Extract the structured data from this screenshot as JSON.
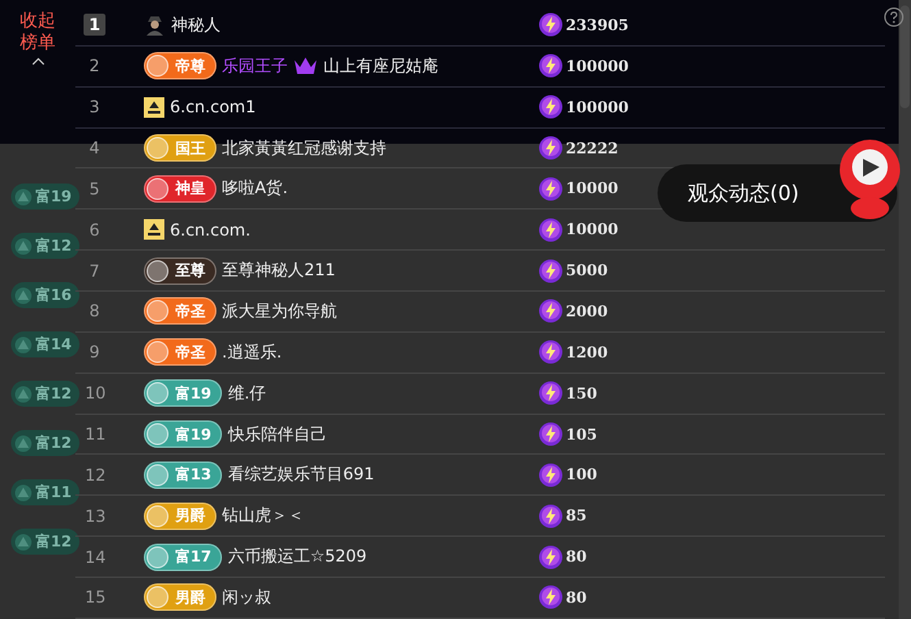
{
  "collapse_button": {
    "label": "收起榜单"
  },
  "chat_badges": [
    {
      "label": "富19"
    },
    {
      "label": "富12"
    },
    {
      "label": "富16"
    },
    {
      "label": "富14"
    },
    {
      "label": "富12"
    },
    {
      "label": "富12"
    },
    {
      "label": "富11"
    },
    {
      "label": "富12"
    }
  ],
  "leaderboard": {
    "rows": [
      {
        "rank": "1",
        "badge": {
          "kind": "avatar"
        },
        "name": "神秘人",
        "score": "233905"
      },
      {
        "rank": "2",
        "badge": {
          "kind": "title",
          "label": "帝尊",
          "color": "#f26a1b"
        },
        "name_highlight": "乐园王子",
        "crown": true,
        "name": "山上有座尼姑庵",
        "score": "100000"
      },
      {
        "rank": "3",
        "badge": {
          "kind": "site"
        },
        "name": "6.cn.com1",
        "score": "100000"
      },
      {
        "rank": "4",
        "badge": {
          "kind": "title",
          "label": "国王",
          "color": "#e0a012"
        },
        "name": "北家黃黃红冠感谢支持",
        "score": "22222"
      },
      {
        "rank": "5",
        "badge": {
          "kind": "title",
          "label": "神皇",
          "color": "#e0262b"
        },
        "name": "哆啦A货.",
        "score": "10000"
      },
      {
        "rank": "6",
        "badge": {
          "kind": "site"
        },
        "name": "6.cn.com.",
        "score": "10000"
      },
      {
        "rank": "7",
        "badge": {
          "kind": "title",
          "label": "至尊",
          "color": "#3a2a22"
        },
        "name": "至尊神秘人211",
        "score": "5000"
      },
      {
        "rank": "8",
        "badge": {
          "kind": "title",
          "label": "帝圣",
          "color": "#f26a1b"
        },
        "name": "派大星为你导航",
        "score": "2000"
      },
      {
        "rank": "9",
        "badge": {
          "kind": "title",
          "label": "帝圣",
          "color": "#f26a1b"
        },
        "name": ".逍遥乐.",
        "score": "1200"
      },
      {
        "rank": "10",
        "badge": {
          "kind": "wealth",
          "label": "富19",
          "color": "#3aa597"
        },
        "name": "维.仔",
        "score": "150"
      },
      {
        "rank": "11",
        "badge": {
          "kind": "wealth",
          "label": "富19",
          "color": "#3aa597"
        },
        "name": "快乐陪伴自己",
        "score": "105"
      },
      {
        "rank": "12",
        "badge": {
          "kind": "wealth",
          "label": "富13",
          "color": "#3aa597"
        },
        "name": "看综艺娱乐节目691",
        "score": "100"
      },
      {
        "rank": "13",
        "badge": {
          "kind": "title",
          "label": "男爵",
          "color": "#e0a012"
        },
        "name": "钻山虎＞＜",
        "score": "85"
      },
      {
        "rank": "14",
        "badge": {
          "kind": "wealth",
          "label": "富17",
          "color": "#3aa597"
        },
        "name": "六币搬运工☆5209",
        "score": "80"
      },
      {
        "rank": "15",
        "badge": {
          "kind": "title",
          "label": "男爵",
          "color": "#e0a012"
        },
        "name": "闲ッ叔",
        "score": "80"
      }
    ]
  },
  "audience_button": {
    "label": "观众动态(0)"
  }
}
